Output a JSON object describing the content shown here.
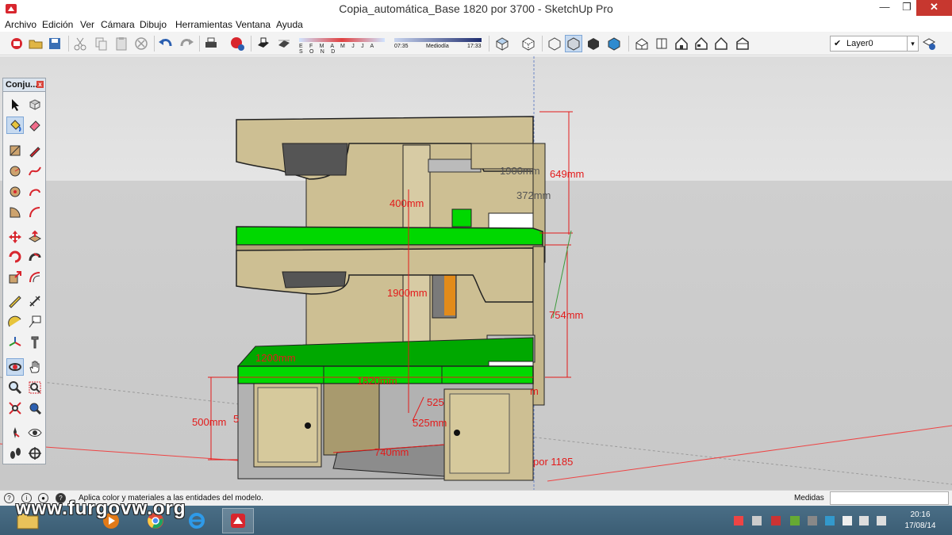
{
  "window": {
    "title": "Copia_automática_Base 1820 por 3700 - SketchUp Pro",
    "minimize": "—",
    "maximize": "❐",
    "close": "✕"
  },
  "menu": [
    "Archivo",
    "Edición",
    "Ver",
    "Cámara",
    "Dibujo",
    "Herramientas",
    "Ventana",
    "Ayuda"
  ],
  "shadows": {
    "months": "E F M A M J J A S O N D",
    "time_start": "07:35",
    "time_mid": "Mediodía",
    "time_end": "17:33"
  },
  "layer": {
    "check": "✔",
    "name": "Layer0",
    "arrow": "▾"
  },
  "palette": {
    "title": "Conju...",
    "close": "x"
  },
  "dimensions": {
    "d649": "649mm",
    "d1900_top": "1900mm",
    "d372": "372mm",
    "d400": "400mm",
    "d1900_mid": "1900mm",
    "d754": "754mm",
    "d1200": "1200mm",
    "d1820": "1820mm",
    "d525a": "525",
    "d525b": "525mm",
    "d500": "500mm",
    "d5": "5",
    "d740": "740mm",
    "por1185": "por 1185",
    "m": "m"
  },
  "status": {
    "hint": "Aplica color y materiales a las entidades del modelo.",
    "measure_label": "Medidas",
    "measure_value": ""
  },
  "taskbar": {
    "watermark": "www.furgovw.org",
    "time": "20:16",
    "date": "17/08/14"
  },
  "colors": {
    "wood": "#cdbf93",
    "green": "#00d800",
    "sky": "#dcdcdc",
    "ground": "#cbcbcb",
    "dimension": "#e31a1a",
    "close_button": "#c7372f"
  }
}
